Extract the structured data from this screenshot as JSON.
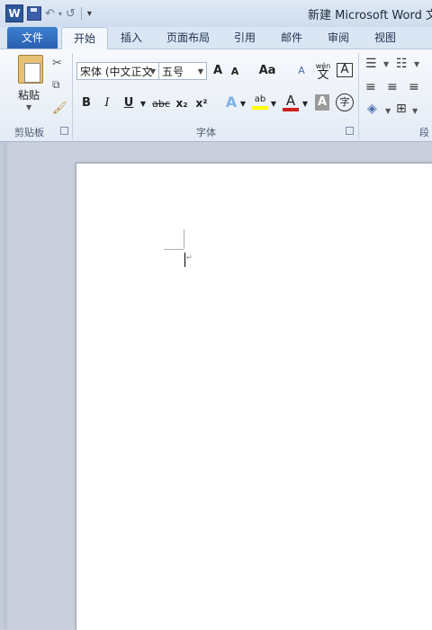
{
  "title_bar": {
    "app_icon_letter": "W",
    "window_title": "新建 Microsoft Word 文",
    "qat_undo": "↶",
    "qat_redo": "↺",
    "qat_customize": "⩡"
  },
  "tabs": [
    {
      "label": "文件",
      "active": false
    },
    {
      "label": "开始",
      "active": true
    },
    {
      "label": "插入",
      "active": false
    },
    {
      "label": "页面布局",
      "active": false
    },
    {
      "label": "引用",
      "active": false
    },
    {
      "label": "邮件",
      "active": false
    },
    {
      "label": "审阅",
      "active": false
    },
    {
      "label": "视图",
      "active": false
    }
  ],
  "ribbon": {
    "clipboard": {
      "paste_label": "粘贴",
      "group_label": "剪贴板"
    },
    "font": {
      "font_name": "宋体 (中文正文",
      "font_size": "五号",
      "grow": "A",
      "shrink": "A",
      "change_case": "Aa",
      "clear_format": "A",
      "pinyin": "wén",
      "pinyin_char": "文",
      "char_border": "A",
      "bold": "B",
      "italic": "I",
      "underline": "U",
      "strikethrough": "abc",
      "subscript": "x₂",
      "superscript": "x²",
      "text_effect": "A",
      "highlight": "ab",
      "font_color": "A",
      "char_shading": "A",
      "enclose_char": "字",
      "group_label": "字体"
    },
    "paragraph": {
      "group_label": "段"
    }
  },
  "colors": {
    "file_tab": "#2a5fb0",
    "highlight": "#ffff00",
    "font_color": "#d02020"
  }
}
